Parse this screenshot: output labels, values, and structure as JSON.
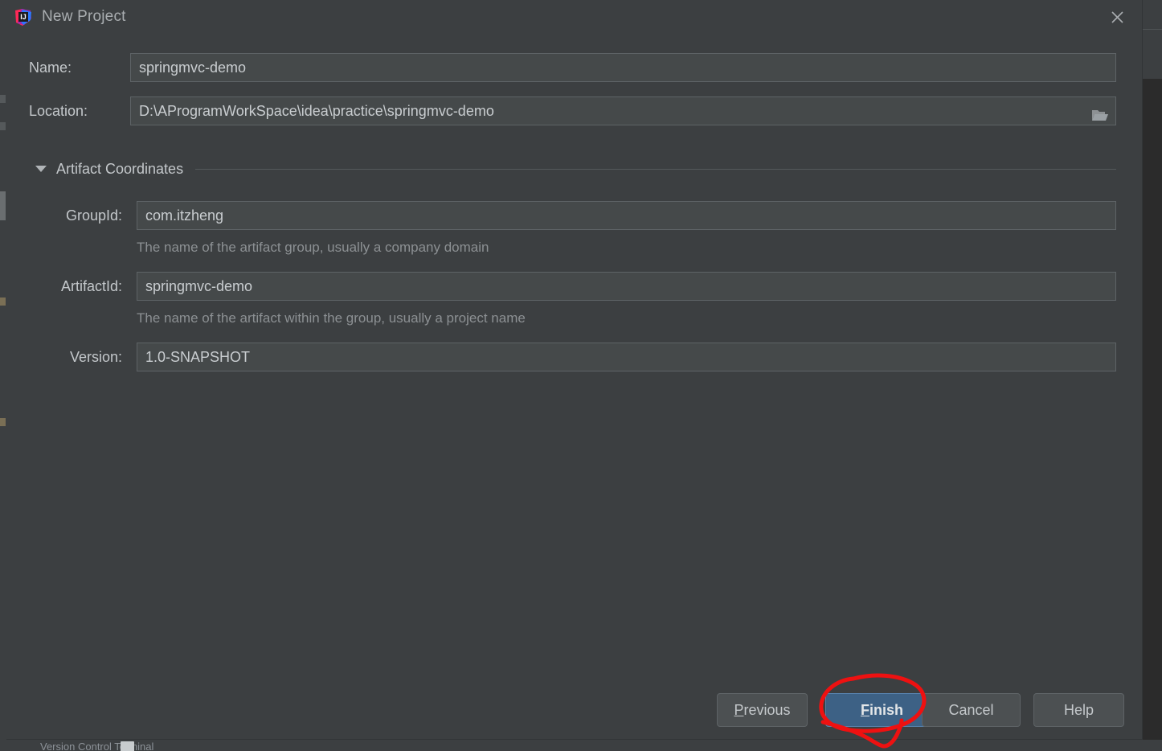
{
  "window": {
    "title": "New Project",
    "app_icon": "intellij-idea-icon",
    "close_icon": "close-icon"
  },
  "form": {
    "name": {
      "label": "Name:",
      "value": "springmvc-demo",
      "placeholder": ""
    },
    "location": {
      "label": "Location:",
      "value": "D:\\AProgramWorkSpace\\idea\\practice\\springmvc-demo",
      "placeholder": "",
      "browse_icon": "folder-icon"
    },
    "artifact_section": {
      "title": "Artifact Coordinates",
      "expanded": true,
      "toggle_icon": "triangle-down-icon"
    },
    "group_id": {
      "label": "GroupId:",
      "value": "com.itzheng",
      "hint": "The name of the artifact group, usually a company domain"
    },
    "artifact_id": {
      "label": "ArtifactId:",
      "value": "springmvc-demo",
      "hint": "The name of the artifact within the group, usually a project name"
    },
    "version": {
      "label": "Version:",
      "value": "1.0-SNAPSHOT",
      "hint": ""
    }
  },
  "buttons": {
    "previous": {
      "label": "Previous",
      "mnemonic": "P"
    },
    "finish": {
      "label": "Finish",
      "mnemonic": "F",
      "primary": true
    },
    "cancel": {
      "label": "Cancel",
      "mnemonic": ""
    },
    "help": {
      "label": "Help",
      "mnemonic": ""
    }
  },
  "annotation": {
    "shape": "hand-drawn-red-circle",
    "color": "#ee1111",
    "targets": "finish-button"
  },
  "background": {
    "bottom_bar_text": "Version Control     Terminal",
    "chevron_icon": "chevron-left-icon"
  },
  "colors": {
    "dialog_bg": "#3c3f41",
    "input_bg": "#45494a",
    "input_border": "#5e6366",
    "text": "#c4c8cb",
    "hint_text": "#8c9093",
    "primary_button": "#3d6185",
    "annotation_red": "#ee1111",
    "editor_bg": "#2b2b2b"
  }
}
